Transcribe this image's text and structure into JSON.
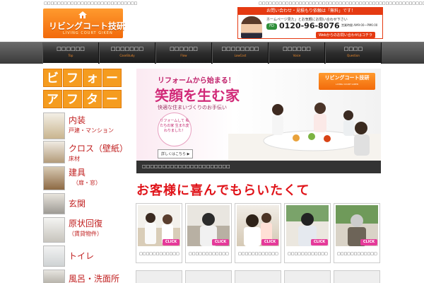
{
  "header": {
    "top_text_left": "□□□□□□□□□□□□□□□□□□□□□□□□□□□□",
    "top_text_right": "□□□□□□□□□□□□□□□□□□□□□□□□□□□□□□□□□□□□□□□□□□□□□□□□□□□□",
    "logo": {
      "name": "リビングコート技研",
      "sub": "LIVING COURT GIKEN"
    },
    "contact": {
      "strip": "お問い合わせ・見積もり依頼は「無料」です！",
      "sub": "ホームページ見た」とお気軽にお問い合わせ下さい",
      "free_dial": "FD",
      "tel": "0120-96-8076",
      "hours": "営業時間 AM9:00〜PM6:00",
      "web": "Webからのお問い合わせはコチラ"
    }
  },
  "nav": [
    {
      "jp": "□□□□□□",
      "en": "Top"
    },
    {
      "jp": "□□□□□□□",
      "en": "CaseStudy"
    },
    {
      "jp": "□□□□□□",
      "en": "Flow"
    },
    {
      "jp": "□□□□□□□□",
      "en": "LowCost"
    },
    {
      "jp": "□□□□□□",
      "en": "Voice"
    },
    {
      "jp": "□□□□",
      "en": "Question"
    }
  ],
  "sidebar": {
    "before_after": [
      "ビ",
      "フ",
      "ォ",
      "ー",
      "ア",
      "フ",
      "タ",
      "ー"
    ],
    "categories": [
      {
        "t1": "内装",
        "t2": "戸建・マンション"
      },
      {
        "t1": "クロス（壁紙）",
        "t2": "床材"
      },
      {
        "t1": "建具",
        "t2": "（扉・窓）"
      },
      {
        "t1": "玄関",
        "t2": ""
      },
      {
        "t1": "原状回復",
        "t2": "（賃貸物件）"
      },
      {
        "t1": "トイレ",
        "t2": ""
      },
      {
        "t1": "風呂・洗面所",
        "t2": ""
      }
    ]
  },
  "banner": {
    "lead": "リフォームから始まる！",
    "headline": "笑顔を生む家",
    "tagline": "快適な住まいづくりのお手伝い",
    "bubble": "リフォームして 私たちの家 生まれ変わりました！",
    "detail": "詳しくはこちら ▶",
    "badge": "リビングコート技研",
    "badge_sub": "LIVING COURT GIKEN",
    "caption": "□□□□□□□□□□□□□□□□□□□□□□"
  },
  "welcome": "お客様に喜んでもらいたくて",
  "cards": [
    {
      "label": "□□□□□□□□□□□□",
      "click": "CLICK"
    },
    {
      "label": "□□□□□□□□□□□□",
      "click": "CLICK"
    },
    {
      "label": "□□□□□□□□□□□□",
      "click": "CLICK"
    },
    {
      "label": "□□□□□□□□□□□□",
      "click": "CLICK"
    },
    {
      "label": "□□□□□□□□□□□□",
      "click": "CLICK"
    }
  ],
  "colors": {
    "accent": "#f26a0b",
    "brand_red": "#e53a12",
    "pink": "#d12a78"
  }
}
